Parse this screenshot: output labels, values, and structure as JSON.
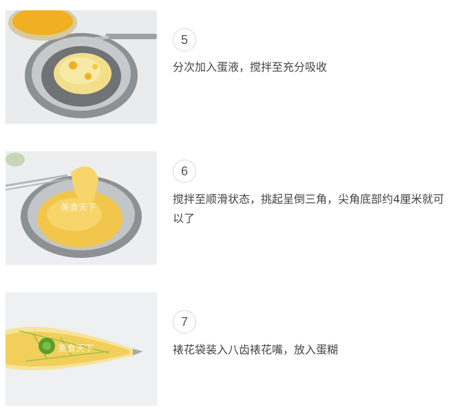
{
  "steps": [
    {
      "number": "5",
      "text": "分次加入蛋液，搅拌至充分吸收",
      "image_icon": "egg-batter-mixing-photo"
    },
    {
      "number": "6",
      "text": "搅拌至顺滑状态，挑起呈倒三角，尖角底部约4厘米就可以了",
      "image_icon": "batter-whisk-photo",
      "watermark": "美食天下"
    },
    {
      "number": "7",
      "text": "裱花袋装入八齿裱花嘴，放入蛋糊",
      "image_icon": "piping-bag-photo",
      "watermark": "美食天下"
    }
  ],
  "colors": {
    "batter": "#f2c64a",
    "egg": "#f0b021",
    "bowl": "#b9bcbe",
    "text": "#444444",
    "circle_border": "#d6d6d6"
  }
}
